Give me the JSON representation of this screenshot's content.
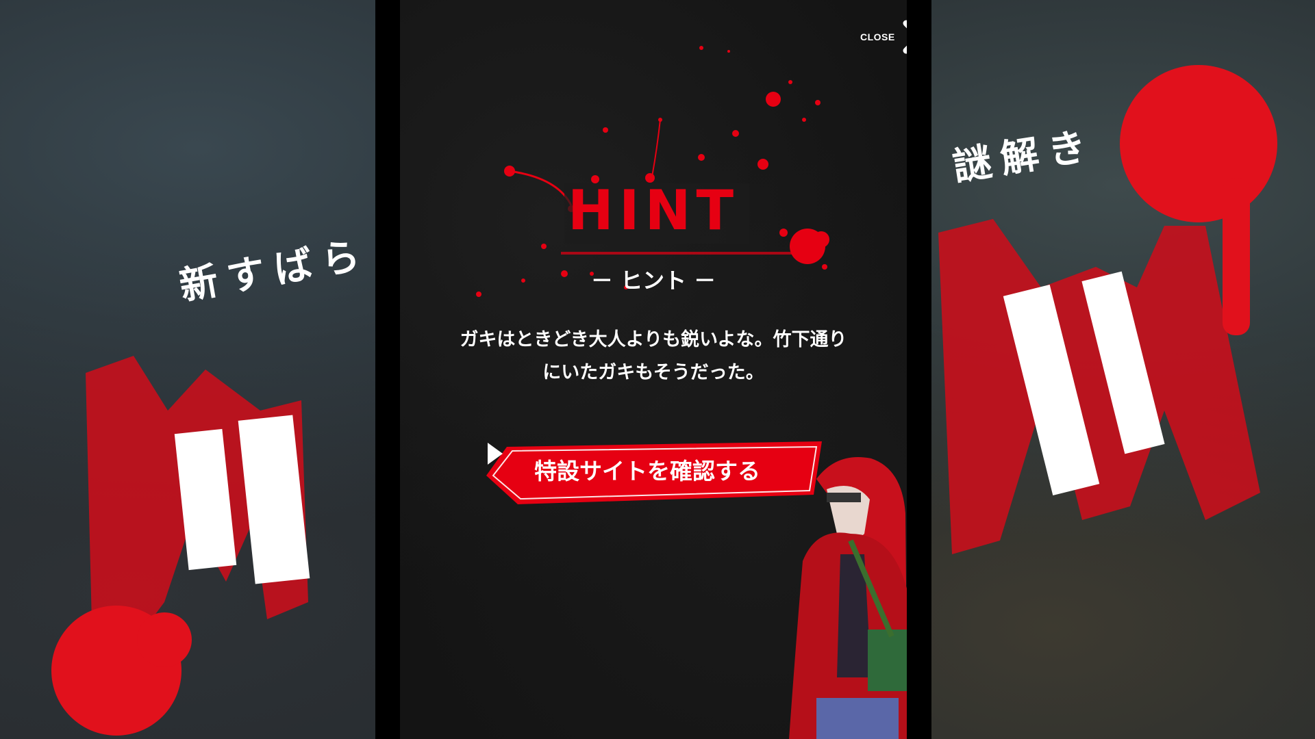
{
  "background": {
    "left_text": "新すばら",
    "left_big_text": "井列",
    "right_text": "謎解き",
    "right_big_text": "ション"
  },
  "modal": {
    "close_label": "CLOSE",
    "title": "HINT",
    "subtitle": "－ ヒント －",
    "hint_lines": [
      "ガキはときどき大人よりも鋭いよな。竹下通り",
      "にいたガキもそうだった。"
    ],
    "cta_label": "特設サイトを確認する"
  },
  "colors": {
    "accent_red": "#e60012",
    "modal_bg": "#141414",
    "text": "#ffffff"
  }
}
